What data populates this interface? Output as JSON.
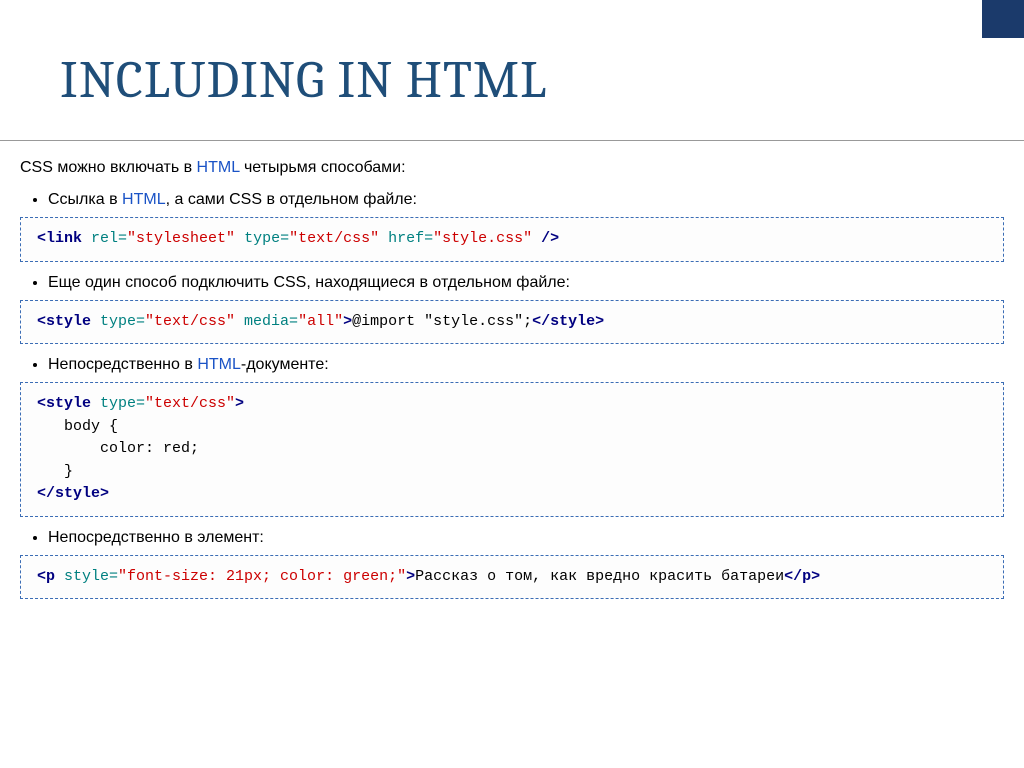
{
  "title": "INCLUDING IN HTML",
  "intro": {
    "pre": "CSS можно включать в ",
    "link": "HTML",
    "post": " четырьмя способами:"
  },
  "items": [
    {
      "label": {
        "pre": "Ссылка в ",
        "link": "HTML",
        "post": ", а сами CSS в отдельном файле:"
      }
    },
    {
      "label": {
        "text": "Еще один способ подключить CSS, находящиеся в отдельном файле:"
      }
    },
    {
      "label": {
        "pre": "Непосредственно в ",
        "link": "HTML",
        "post": "-документе:"
      }
    },
    {
      "label": {
        "text": "Непосредственно в элемент:"
      }
    }
  ],
  "code1": {
    "t_open": "<link ",
    "a1": "rel=",
    "v1": "\"stylesheet\"",
    "a2": " type=",
    "v2": "\"text/css\"",
    "a3": " href=",
    "v3": "\"style.css\"",
    "t_close": " />"
  },
  "code2": {
    "t_open": "<style ",
    "a1": "type=",
    "v1": "\"text/css\"",
    "a2": " media=",
    "v2": "\"all\"",
    "t_mid": ">",
    "body": "@import \"style.css\";",
    "t_close": "</style>"
  },
  "code3": {
    "l1_open": "<style ",
    "l1_a": "type=",
    "l1_v": "\"text/css\"",
    "l1_close": ">",
    "l2": "   body {",
    "l3": "       color: red;",
    "l4": "   }",
    "l5": "</style>"
  },
  "code4": {
    "t_open": "<p ",
    "a1": "style=",
    "v1": "\"font-size: 21px; color: green;\"",
    "t_mid": ">",
    "body": "Рассказ о том, как вредно красить батареи",
    "t_close": "</p>"
  }
}
